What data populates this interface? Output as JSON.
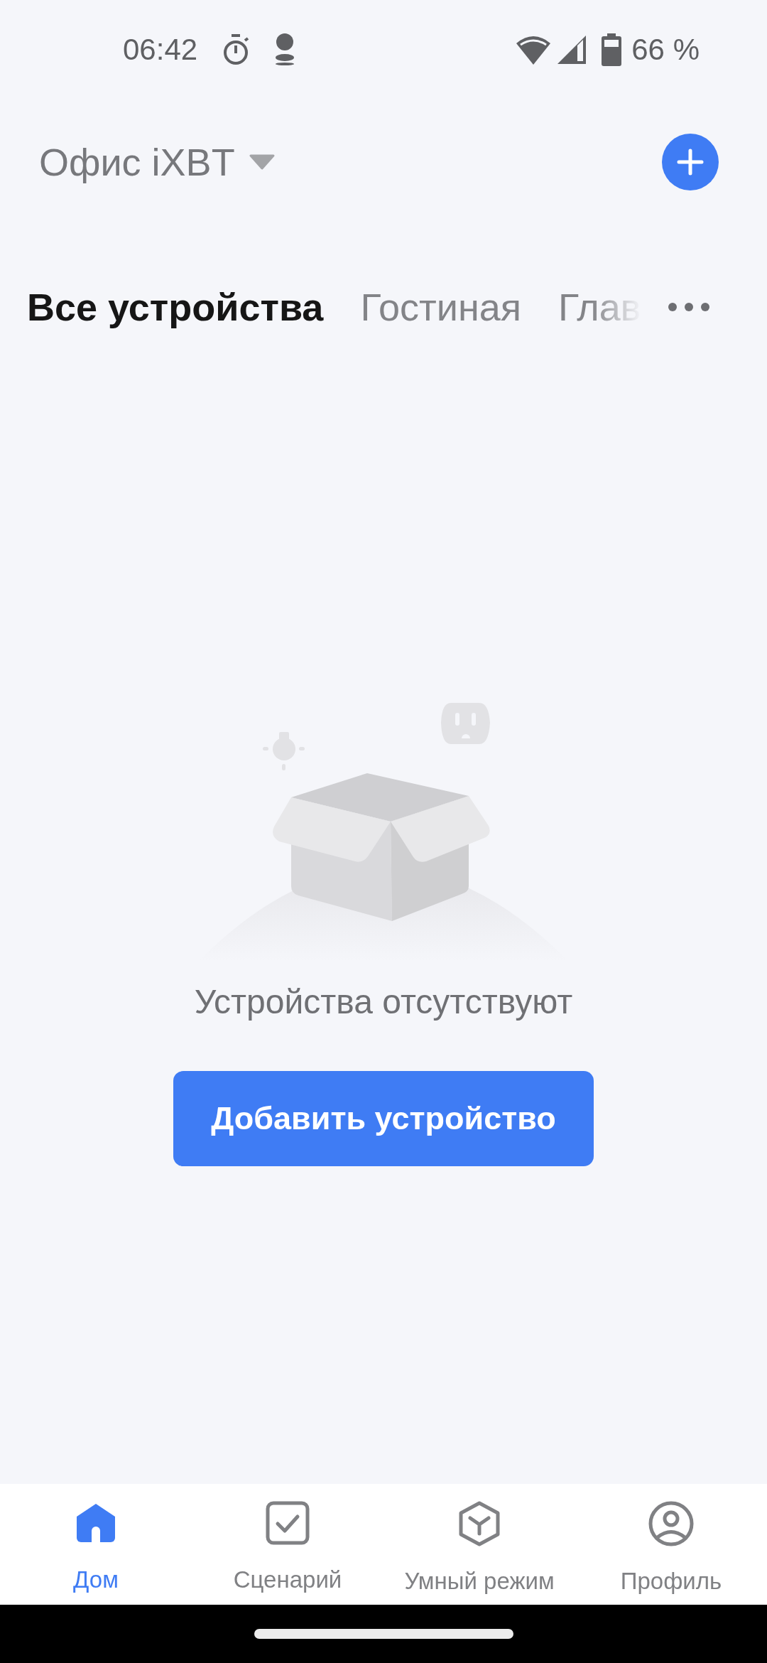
{
  "status_bar": {
    "time": "06:42",
    "battery": "66 %"
  },
  "header": {
    "home_name": "Офис iXBT"
  },
  "tabs": [
    {
      "label": "Все устройства",
      "selected": true
    },
    {
      "label": "Гостиная",
      "selected": false
    },
    {
      "label": "Глав",
      "selected": false
    }
  ],
  "empty_state": {
    "message": "Устройства отсутствуют",
    "button": "Добавить устройство"
  },
  "bottom_nav": [
    {
      "kind": "home",
      "label": "Дом",
      "selected": true
    },
    {
      "kind": "scene",
      "label": "Сценарий",
      "selected": false
    },
    {
      "kind": "smart",
      "label": "Умный режим",
      "selected": false
    },
    {
      "kind": "profile",
      "label": "Профиль",
      "selected": false
    }
  ]
}
